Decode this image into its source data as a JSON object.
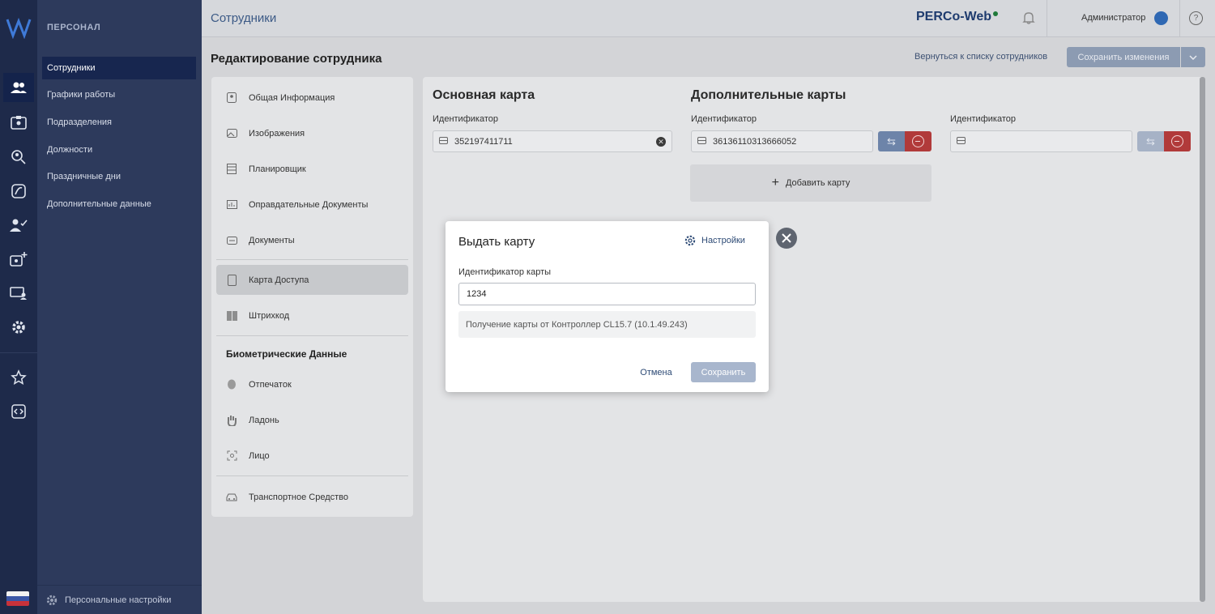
{
  "menu": {
    "section": "ПЕРСОНАЛ",
    "items": [
      "Сотрудники",
      "Графики работы",
      "Подразделения",
      "Должности",
      "Праздничные дни",
      "Дополнительные данные"
    ],
    "footer": "Персональные настройки"
  },
  "header": {
    "title": "Сотрудники",
    "brand": "PERCo-Web",
    "user": "Администратор",
    "help": "?"
  },
  "page": {
    "title": "Редактирование сотрудника",
    "back_link": "Вернуться к списку сотрудников",
    "save_button": "Сохранить изменения"
  },
  "leftnav": {
    "items": [
      "Общая Информация",
      "Изображения",
      "Планировщик",
      "Оправдательные Документы",
      "Документы",
      "Карта Доступа",
      "Штрихкод"
    ],
    "bio_heading": "Биометрические Данные",
    "bio_items": [
      "Отпечаток",
      "Ладонь",
      "Лицо"
    ],
    "vehicle": "Транспортное Средство"
  },
  "content": {
    "main_card_title": "Основная карта",
    "extra_cards_title": "Дополнительные карты",
    "id_label": "Идентификатор",
    "main_card_value": "352197411711",
    "extra_card_1_value": "36136110313666052",
    "extra_card_2_value": "",
    "add_card": "Добавить карту"
  },
  "modal": {
    "title": "Выдать карту",
    "settings": "Настройки",
    "field_label": "Идентификатор карты",
    "field_value": "1234",
    "info": "Получение карты от Контроллер CL15.7 (10.1.49.243)",
    "cancel": "Отмена",
    "save": "Сохранить"
  },
  "colors": {
    "rail": "#1e2a4a",
    "menu": "#2d3a5c",
    "accent": "#2d4a75",
    "danger": "#b13a3a"
  }
}
